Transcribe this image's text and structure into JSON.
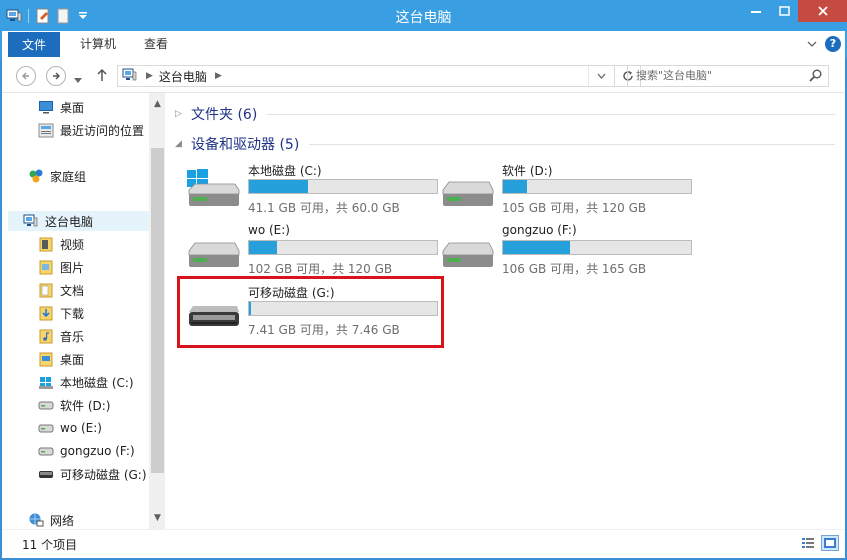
{
  "window": {
    "title": "这台电脑",
    "controls": [
      "minimize",
      "maximize",
      "close"
    ]
  },
  "ribbon": {
    "tabs": [
      "文件",
      "计算机",
      "查看"
    ]
  },
  "address_bar": {
    "path": "这台电脑",
    "search_placeholder": "搜索\"这台电脑\""
  },
  "nav_pane": {
    "items": [
      {
        "label": "桌面",
        "icon": "desktop-icon"
      },
      {
        "label": "最近访问的位置",
        "icon": "recent-places-icon"
      },
      {
        "label": "家庭组",
        "icon": "homegroup-icon"
      },
      {
        "label": "这台电脑",
        "icon": "computer-icon",
        "selected": true
      },
      {
        "label": "视频",
        "icon": "videos-folder-icon"
      },
      {
        "label": "图片",
        "icon": "pictures-folder-icon"
      },
      {
        "label": "文档",
        "icon": "documents-folder-icon"
      },
      {
        "label": "下载",
        "icon": "downloads-folder-icon"
      },
      {
        "label": "音乐",
        "icon": "music-folder-icon"
      },
      {
        "label": "桌面",
        "icon": "desktop-folder-icon"
      },
      {
        "label": "本地磁盘 (C:)",
        "icon": "windows-drive-icon"
      },
      {
        "label": "软件 (D:)",
        "icon": "drive-icon"
      },
      {
        "label": "wo (E:)",
        "icon": "drive-icon"
      },
      {
        "label": "gongzuo (F:)",
        "icon": "drive-icon"
      },
      {
        "label": "可移动磁盘 (G:)",
        "icon": "removable-drive-icon"
      },
      {
        "label": "网络",
        "icon": "network-icon"
      }
    ]
  },
  "content": {
    "folders_group": "文件夹 (6)",
    "devices_group": "设备和驱动器 (5)",
    "drives": [
      {
        "name": "本地磁盘 (C:)",
        "size_text": "41.1 GB 可用，共 60.0 GB",
        "used_fraction": 0.315,
        "icon": "windows-drive-icon"
      },
      {
        "name": "软件 (D:)",
        "size_text": "105 GB 可用，共 120 GB",
        "used_fraction": 0.125,
        "icon": "drive-icon"
      },
      {
        "name": "wo (E:)",
        "size_text": "102 GB 可用，共 120 GB",
        "used_fraction": 0.15,
        "icon": "drive-icon"
      },
      {
        "name": "gongzuo (F:)",
        "size_text": "106 GB 可用，共 165 GB",
        "used_fraction": 0.357,
        "icon": "drive-icon"
      },
      {
        "name": "可移动磁盘 (G:)",
        "size_text": "7.41 GB 可用，共 7.46 GB",
        "used_fraction": 0.007,
        "icon": "removable-drive-icon",
        "highlighted": true
      }
    ]
  },
  "status_bar": {
    "item_count": "11 个项目"
  },
  "colors": {
    "titlebar": "#3a9ee3",
    "file_tab": "#1c6dbe",
    "usage_bar": "#26a0da",
    "highlight_box": "#d9121b",
    "group_header": "#1e3287"
  }
}
